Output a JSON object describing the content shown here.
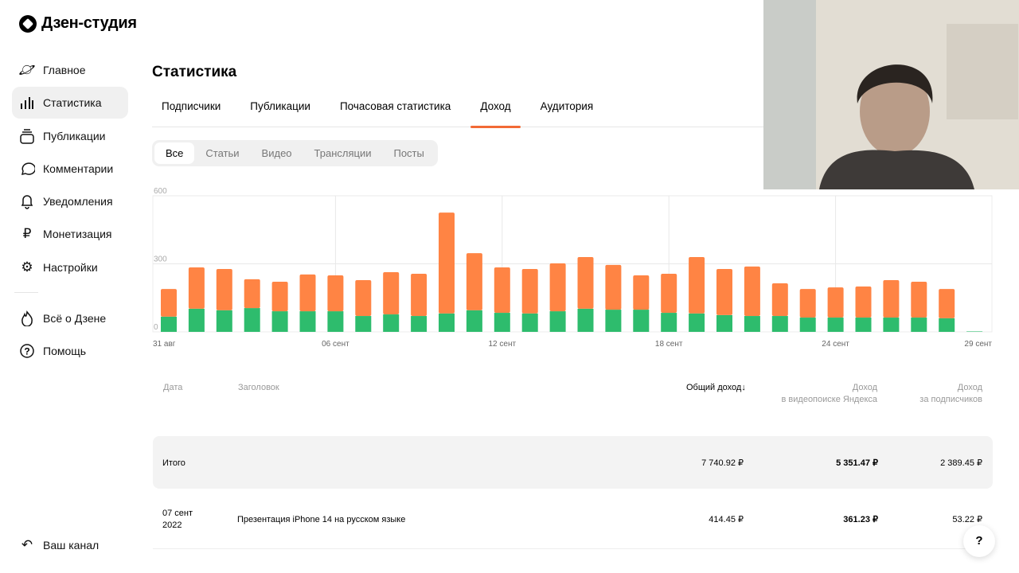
{
  "app": {
    "title": "Дзен-студия"
  },
  "sidebar": {
    "items": [
      {
        "label": "Главное",
        "icon": "planet-icon"
      },
      {
        "label": "Статистика",
        "icon": "bar-chart-icon",
        "active": true
      },
      {
        "label": "Публикации",
        "icon": "stack-icon"
      },
      {
        "label": "Комментарии",
        "icon": "comment-icon"
      },
      {
        "label": "Уведомления",
        "icon": "bell-icon"
      },
      {
        "label": "Монетизация",
        "icon": "ruble-icon"
      },
      {
        "label": "Настройки",
        "icon": "gear-icon"
      },
      {
        "label": "Всё о Дзене",
        "icon": "flame-icon"
      },
      {
        "label": "Помощь",
        "icon": "question-circle-icon"
      },
      {
        "label": "Ваш канал",
        "icon": "back-arrow-icon"
      }
    ]
  },
  "page": {
    "title": "Статистика"
  },
  "tabs": [
    {
      "label": "Подписчики"
    },
    {
      "label": "Публикации"
    },
    {
      "label": "Почасовая статистика"
    },
    {
      "label": "Доход",
      "active": true
    },
    {
      "label": "Аудитория"
    }
  ],
  "filters": [
    {
      "label": "Все",
      "active": true
    },
    {
      "label": "Статьи"
    },
    {
      "label": "Видео"
    },
    {
      "label": "Трансляции"
    },
    {
      "label": "Посты"
    }
  ],
  "colors": {
    "accent": "#f26a35",
    "orange": "#ff8444",
    "green": "#2ebc6d"
  },
  "chart_data": {
    "type": "bar",
    "stacked": true,
    "ylim": [
      0,
      600
    ],
    "yticks": [
      "0",
      "300",
      "600"
    ],
    "xtick_labels": [
      "31 авг",
      "06 сент",
      "12 сент",
      "18 сент",
      "24 сент",
      "29 сент"
    ],
    "grid": true,
    "categories": [
      "31 авг",
      "01 сент",
      "02 сент",
      "03 сент",
      "04 сент",
      "05 сент",
      "06 сент",
      "07 сент",
      "08 сент",
      "09 сент",
      "10 сент",
      "11 сент",
      "12 сент",
      "13 сент",
      "14 сент",
      "15 сент",
      "16 сент",
      "17 сент",
      "18 сент",
      "19 сент",
      "20 сент",
      "21 сент",
      "22 сент",
      "23 сент",
      "24 сент",
      "25 сент",
      "26 сент",
      "27 сент",
      "28 сент",
      "29 сент"
    ],
    "series": [
      {
        "color": "#2ebc6d",
        "values": [
          67,
          102,
          95,
          105,
          91,
          91,
          91,
          70,
          77,
          70,
          81,
          95,
          84,
          81,
          91,
          102,
          98,
          98,
          84,
          81,
          74,
          70,
          70,
          63,
          63,
          63,
          63,
          63,
          60,
          2
        ]
      },
      {
        "color": "#ff8444",
        "values": [
          122,
          182,
          182,
          127,
          130,
          162,
          158,
          158,
          186,
          186,
          445,
          252,
          200,
          196,
          211,
          228,
          197,
          151,
          172,
          249,
          203,
          218,
          144,
          126,
          133,
          137,
          165,
          158,
          129,
          0
        ]
      }
    ]
  },
  "table": {
    "headers": {
      "date": "Дата",
      "title": "Заголовок",
      "total": "Общий доход",
      "total_sort": "↓",
      "video_search_1": "Доход",
      "video_search_2": "в видеопоиске Яндекса",
      "subs_1": "Доход",
      "subs_2": "за подписчиков"
    },
    "summary": {
      "label": "Итого",
      "total": "7 740.92 ₽",
      "video_search": "5 351.47 ₽",
      "subs": "2 389.45 ₽"
    },
    "rows": [
      {
        "date_1": "07 сент",
        "date_2": "2022",
        "title": "Презентация iPhone 14 на русском языке",
        "total": "414.45 ₽",
        "video_search": "361.23 ₽",
        "subs": "53.22 ₽"
      }
    ]
  },
  "help": {
    "label": "?"
  }
}
